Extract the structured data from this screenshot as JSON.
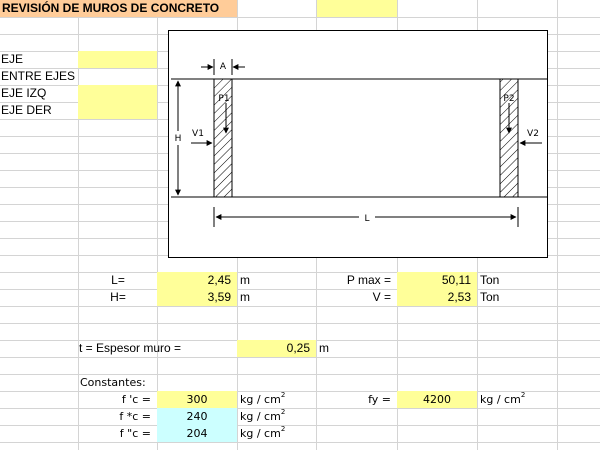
{
  "title": "REVISIÓN DE MUROS DE CONCRETO",
  "axes": {
    "eje": "EJE",
    "entre_ejes": "ENTRE EJES",
    "eje_izq": "EJE IZQ",
    "eje_der": "EJE DER"
  },
  "diagram": {
    "a_label": "A",
    "h_label": "H",
    "l_label": "L",
    "p1_label": "P1",
    "p2_label": "P2",
    "v1_label": "V1",
    "v2_label": "V2"
  },
  "params": {
    "L": {
      "label": "L=",
      "value": "2,45",
      "unit": "m"
    },
    "H": {
      "label": "H=",
      "value": "3,59",
      "unit": "m"
    },
    "Pmax": {
      "label": "P max =",
      "value": "50,11",
      "unit": "Ton"
    },
    "V": {
      "label": "V =",
      "value": "2,53",
      "unit": "Ton"
    }
  },
  "thickness": {
    "label": "t = Espesor muro =",
    "value": "0,25",
    "unit": "m"
  },
  "constants": {
    "header": "Constantes:",
    "fc": {
      "label": "f 'c =",
      "value": "300",
      "unit": "kg / cm",
      "exp": "2"
    },
    "fc_star": {
      "label": "f *c =",
      "value": "240",
      "unit": "kg / cm",
      "exp": "2"
    },
    "fc_2star": {
      "label": "f \"c =",
      "value": "204",
      "unit": "kg / cm",
      "exp": "2"
    },
    "fy": {
      "label": "fy =",
      "value": "4200",
      "unit": "kg / cm",
      "exp": "2"
    }
  },
  "colors": {
    "orange_fill": "#ffcc99",
    "yellow_fill": "#ffff99",
    "cyan_fill": "#ccffff",
    "grid": "#d4d4d4"
  }
}
